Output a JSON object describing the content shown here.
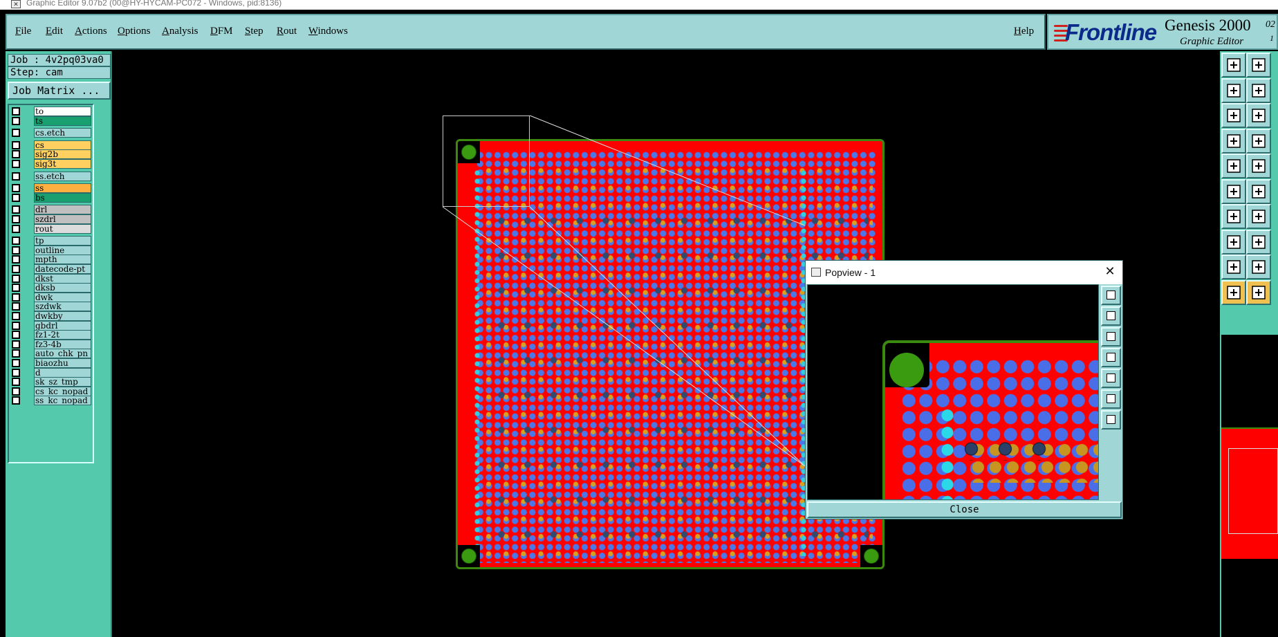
{
  "window": {
    "title": "Graphic Editor 9.07b2 (00@HY-HYCAM-PC072 - Windows, pid:8136)"
  },
  "menu": {
    "file": "File",
    "edit": "Edit",
    "actions": "Actions",
    "options": "Options",
    "analysis": "Analysis",
    "dfm": "DFM",
    "step": "Step",
    "rout": "Rout",
    "windows": "Windows",
    "help": "Help"
  },
  "logo": {
    "brand": "Frontline",
    "product": "Genesis 2000",
    "sup": "02",
    "sub": "1",
    "subtitle": "Graphic Editor"
  },
  "job": {
    "job_label": "Job : 4v2pq03va0",
    "step_label": "Step: cam",
    "job_matrix_button": "Job Matrix ..."
  },
  "layers": [
    {
      "name": "to",
      "color": "#ffffff"
    },
    {
      "name": "ts",
      "color": "#1aa070"
    },
    {
      "name": "cs.etch",
      "color": "#a0d6d6"
    },
    {
      "name": "cs",
      "color": "#ffd060"
    },
    {
      "name": "sig2b",
      "color": "#ffd060"
    },
    {
      "name": "sig3t",
      "color": "#ffd060"
    },
    {
      "name": "ss.etch",
      "color": "#a0d6d6"
    },
    {
      "name": "ss",
      "color": "#ffb040"
    },
    {
      "name": "bs",
      "color": "#1aa070"
    },
    {
      "name": "drl",
      "color": "#c0c0c0"
    },
    {
      "name": "szdrl",
      "color": "#c0c0c0"
    },
    {
      "name": "rout",
      "color": "#dcdcdc"
    },
    {
      "name": "tp",
      "color": "#a0d6d6"
    },
    {
      "name": "outline",
      "color": "#a0d6d6"
    },
    {
      "name": "mpth",
      "color": "#a0d6d6"
    },
    {
      "name": "datecode-pt",
      "color": "#a0d6d6"
    },
    {
      "name": "dkst",
      "color": "#a0d6d6"
    },
    {
      "name": "dksb",
      "color": "#a0d6d6"
    },
    {
      "name": "dwk",
      "color": "#a0d6d6"
    },
    {
      "name": "szdwk",
      "color": "#a0d6d6"
    },
    {
      "name": "dwkby",
      "color": "#a0d6d6"
    },
    {
      "name": "gbdrl",
      "color": "#a0d6d6"
    },
    {
      "name": "fz1-2t",
      "color": "#a0d6d6"
    },
    {
      "name": "fz3-4b",
      "color": "#a0d6d6"
    },
    {
      "name": "auto_chk_pn",
      "color": "#a0d6d6"
    },
    {
      "name": "biaozhu",
      "color": "#a0d6d6"
    },
    {
      "name": "d",
      "color": "#a0d6d6"
    },
    {
      "name": "sk_sz_tmp",
      "color": "#a0d6d6"
    },
    {
      "name": "cs_kc_nopad",
      "color": "#a0d6d6"
    },
    {
      "name": "ss_kc_nopad",
      "color": "#a0d6d6"
    }
  ],
  "popview": {
    "title": "Popview - 1",
    "close_button": "Close"
  },
  "colors": {
    "panel": "#a0d6d6",
    "sidebar": "#55c9ab",
    "board": "#ff0000",
    "board_edge": "#3a8a10"
  }
}
